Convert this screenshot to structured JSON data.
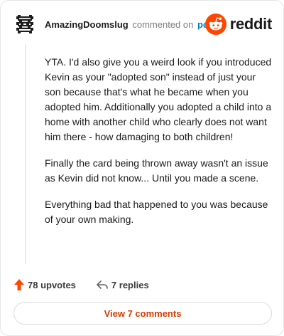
{
  "header": {
    "username": "AmazingDoomslug",
    "commented_on": "commented on",
    "post_link": "post",
    "avatar_icon": "pixel-avatar-icon",
    "brand_icon": "reddit-alien-icon",
    "brand_text": "reddit",
    "brand_color": "#ff4500"
  },
  "comment": {
    "paragraphs": [
      "YTA. I'd also give you a weird look if you introduced Kevin as your \"adopted son\" instead of just your son because that's what he became when you adopted him. Additionally you adopted a child into a home with another child who clearly does not want him there - how damaging to both children!",
      "Finally the card being thrown away wasn't an issue as Kevin did not know... Until you made a scene.",
      "Everything bad that happened to you was because of your own making."
    ]
  },
  "actions": {
    "upvotes_label": "78 upvotes",
    "replies_label": "7 replies",
    "upvote_icon": "upvote-arrow-icon",
    "reply_icon": "reply-icon",
    "upvote_color": "#ff4500"
  },
  "view_button": {
    "label": "View 7 comments",
    "color": "#d93a00"
  }
}
